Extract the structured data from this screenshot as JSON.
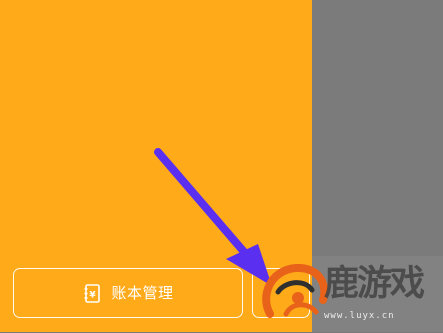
{
  "panel": {
    "ledger_button": {
      "label": "账本管理",
      "icon": "ledger-book-icon",
      "icon_glyph": "¥"
    },
    "second_button": {
      "label": ""
    },
    "colors": {
      "orange": "#ffaa19",
      "overlay": "#7b7b7b",
      "arrow": "#5b2ff0"
    }
  },
  "watermark": {
    "text": "鹿游戏",
    "url": "www.luyx.cn"
  }
}
